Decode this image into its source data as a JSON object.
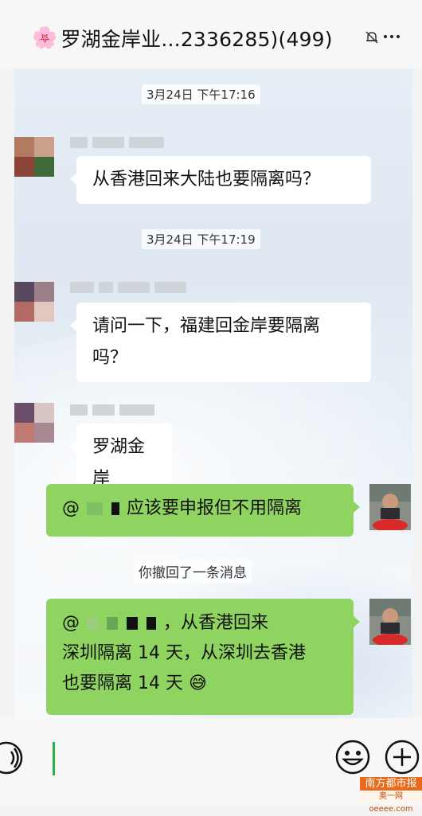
{
  "header": {
    "flower_glyph": "🌸",
    "title": "罗湖金岸业...2336285)(499)"
  },
  "chat": {
    "timestamps": [
      "3月24日 下午17:16",
      "3月24日 下午17:19"
    ],
    "messages": [
      {
        "side": "left",
        "text": "从香港回来大陆也要隔离吗？"
      },
      {
        "side": "left",
        "text_line1": "请问一下，福建回金岸要隔离",
        "text_line2": "吗？"
      },
      {
        "side": "left",
        "text": "罗湖金岸"
      },
      {
        "side": "right",
        "prefix": "@",
        "text": "应该要申报但不用隔离"
      },
      {
        "side": "right",
        "prefix": "@",
        "text_line1_tail": "，从香港回来",
        "text_line2": "深圳隔离 14 天，从深圳去香港",
        "text_line3": "也要隔离 14 天",
        "emoji": "😅"
      }
    ],
    "system_notice": "你撤回了一条消息"
  },
  "watermark": {
    "top": "南方都市报",
    "bottom": "奥一网oeeee.com"
  },
  "colors": {
    "green_bubble": "#8fd461",
    "cursor": "#2eb045",
    "watermark_orange": "#e76b1a"
  },
  "icons": [
    "mute-icon",
    "more-icon",
    "voice-icon",
    "emoji-icon",
    "plus-icon"
  ]
}
